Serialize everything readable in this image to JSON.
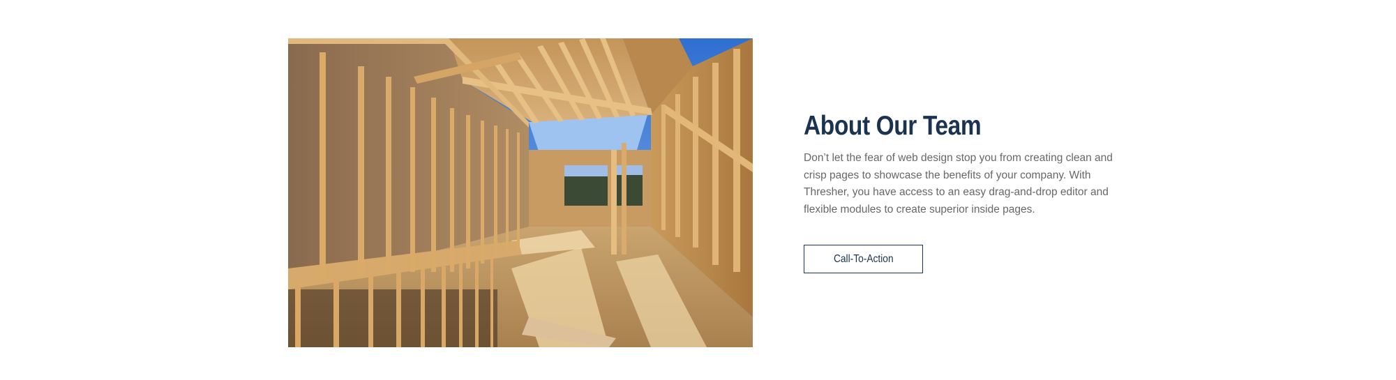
{
  "about": {
    "heading": "About Our Team",
    "body": "Don’t let the fear of web design stop you from creating clean and crisp pages to showcase the benefits of your company. With Thresher, you have access to an easy drag-and-drop editor and flexible modules to create superior inside pages.",
    "cta_label": "Call-To-Action"
  },
  "image": {
    "subject": "house-framing-photo"
  },
  "colors": {
    "heading": "#1b3351",
    "body_text": "#676767",
    "cta_border": "#1b3351",
    "background": "#ffffff"
  }
}
